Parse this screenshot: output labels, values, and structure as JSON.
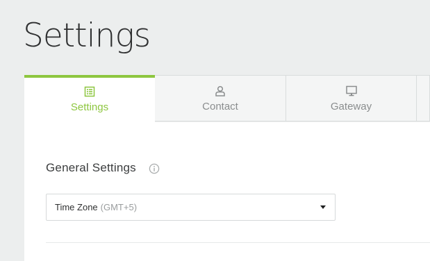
{
  "page": {
    "title": "Settings"
  },
  "tabs": [
    {
      "label": "Settings",
      "icon": "settings-icon",
      "active": true
    },
    {
      "label": "Contact",
      "icon": "contact-icon",
      "active": false
    },
    {
      "label": "Gateway",
      "icon": "monitor-icon",
      "active": false
    }
  ],
  "general": {
    "title": "General Settings",
    "info_icon": "info-icon"
  },
  "timezone": {
    "label": "Time Zone",
    "value": "(GMT+5)"
  },
  "colors": {
    "accent": "#8dc63f",
    "background": "#eceeee",
    "tab_inactive": "#f4f5f5",
    "text_dark": "#2f3031",
    "text_muted": "#8a8d8e"
  }
}
